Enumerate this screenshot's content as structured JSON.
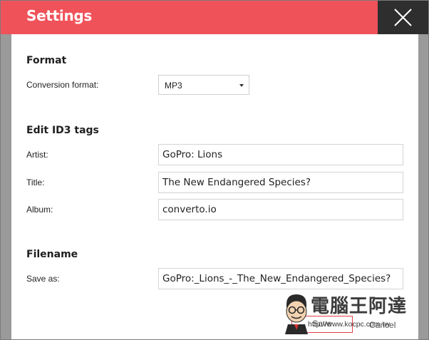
{
  "dialog": {
    "title": "Settings",
    "close_icon": "close-x-icon"
  },
  "format": {
    "section_title": "Format",
    "conversion_label": "Conversion format:",
    "conversion_value": "MP3"
  },
  "id3": {
    "section_title": "Edit ID3 tags",
    "artist_label": "Artist:",
    "artist_value": "GoPro: Lions",
    "title_label": "Title:",
    "title_value": "The New Endangered Species?",
    "album_label": "Album:",
    "album_value": "converto.io"
  },
  "filename": {
    "section_title": "Filename",
    "save_as_label": "Save as:",
    "save_as_value": "GoPro:_Lions_-_The_New_Endangered_Species?"
  },
  "footer": {
    "save_label": "Save",
    "cancel_label": "Cancel"
  },
  "watermark": {
    "text": "電腦王阿達",
    "url": "http://www.kocpc.com.tw"
  },
  "colors": {
    "accent": "#f0525a",
    "close_bg": "#2e2e2e"
  }
}
